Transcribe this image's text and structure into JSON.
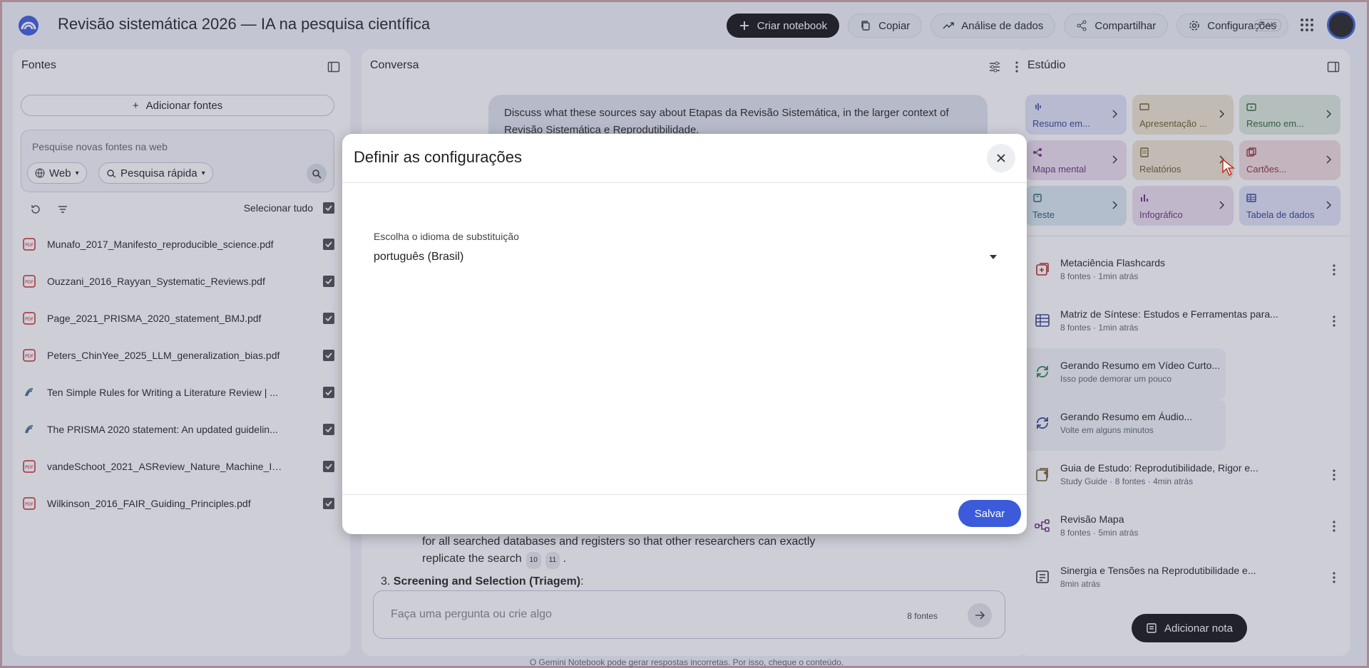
{
  "header": {
    "title": "Revisão sistemática 2026 — IA na pesquisa científica",
    "buttons": {
      "create": "Criar notebook",
      "copy": "Copiar",
      "analysis": "Análise de dados",
      "share": "Compartilhar",
      "settings": "Configurações"
    },
    "plan_badge": "PLUS"
  },
  "sources": {
    "title": "Fontes",
    "add_label": "Adicionar fontes",
    "web_search_placeholder": "Pesquise novas fontes na web",
    "web_chip": "Web",
    "fast_chip": "Pesquisa rápida",
    "select_all": "Selecionar tudo",
    "items": [
      {
        "name": "Munafo_2017_Manifesto_reproducible_science.pdf",
        "icon": "pdf-icon"
      },
      {
        "name": "Ouzzani_2016_Rayyan_Systematic_Reviews.pdf",
        "icon": "pdf-icon"
      },
      {
        "name": "Page_2021_PRISMA_2020_statement_BMJ.pdf",
        "icon": "pdf-icon"
      },
      {
        "name": "Peters_ChinYee_2025_LLM_generalization_bias.pdf",
        "icon": "pdf-icon"
      },
      {
        "name": "Ten Simple Rules for Writing a Literature Review | ...",
        "icon": "web-icon"
      },
      {
        "name": "The PRISMA 2020 statement: An updated guidelin...",
        "icon": "web-icon"
      },
      {
        "name": "vandeSchoot_2021_ASReview_Nature_Machine_In...",
        "icon": "pdf-icon"
      },
      {
        "name": "Wilkinson_2016_FAIR_Guiding_Principles.pdf",
        "icon": "pdf-icon"
      }
    ]
  },
  "conversation": {
    "title": "Conversa",
    "user_message": "Discuss what these sources say about Etapas da Revisão Sistemática, in the larger context of Revisão Sistemática e Reprodutibilidade.",
    "response_line1": "for all searched databases and registers so that other researchers can exactly",
    "response_line2": "replicate the search",
    "cite1": "10",
    "cite2": "11",
    "response_item_num": "3.",
    "response_item_title": "Screening and Selection (Triagem)",
    "input_placeholder": "Faça uma pergunta ou crie algo",
    "source_count": "8 fontes"
  },
  "studio": {
    "title": "Estúdio",
    "tiles": [
      {
        "label": "Resumo em...",
        "bg": "#dfe4f5",
        "fg": "#2f3f8f"
      },
      {
        "label": "Apresentação ...",
        "bg": "#ede5cf",
        "fg": "#6a5a20"
      },
      {
        "label": "Resumo em...",
        "bg": "#dcebdc",
        "fg": "#2d5d33"
      },
      {
        "label": "Mapa mental",
        "bg": "#ece0ee",
        "fg": "#6a2e78"
      },
      {
        "label": "Relatórios",
        "bg": "#ede5cf",
        "fg": "#6a5a20"
      },
      {
        "label": "Cartões...",
        "bg": "#f1dcdc",
        "fg": "#8a2f2f"
      },
      {
        "label": "Teste",
        "bg": "#d8e9ef",
        "fg": "#1f5c70"
      },
      {
        "label": "Infográfico",
        "bg": "#ece0ee",
        "fg": "#6a2e78"
      },
      {
        "label": "Tabela de dados",
        "bg": "#dfe4f5",
        "fg": "#2f3f8f"
      }
    ],
    "notes": [
      {
        "title": "Metaciência Flashcards",
        "sub": "8 fontes · 1min atrás",
        "icon": "flashcard-icon",
        "color": "#b3261e"
      },
      {
        "title": "Matriz de Síntese: Estudos e Ferramentas para...",
        "sub": "8 fontes · 1min atrás",
        "icon": "table-icon",
        "color": "#2f3f8f"
      },
      {
        "title": "Gerando Resumo em Vídeo Curto...",
        "sub": "Isso pode demorar um pouco",
        "icon": "sync-icon",
        "color": "#2d7d46"
      },
      {
        "title": "Gerando Resumo em Áudio...",
        "sub": "Volte em alguns minutos",
        "icon": "sync-icon",
        "color": "#2f3f8f"
      },
      {
        "title": "Guia de Estudo: Reprodutibilidade, Rigor e...",
        "sub": "Study Guide · 8 fontes · 4min atrás",
        "icon": "study-guide-icon",
        "color": "#6a5a20"
      },
      {
        "title": "Revisão Mapa",
        "sub": "8 fontes · 5min atrás",
        "icon": "mindmap-icon",
        "color": "#6a2e78"
      },
      {
        "title": "Sinergia e Tensões na Reprodutibilidade e...",
        "sub": "8min atrás",
        "icon": "note-icon",
        "color": "#333"
      }
    ],
    "add_note": "Adicionar nota"
  },
  "disclaimer": "O Gemini Notebook pode gerar respostas incorretas. Por isso, cheque o conteúdo.",
  "dialog": {
    "title": "Definir as configurações",
    "field_label": "Escolha o idioma de substituição",
    "selected_language": "português (Brasil)",
    "save": "Salvar"
  }
}
